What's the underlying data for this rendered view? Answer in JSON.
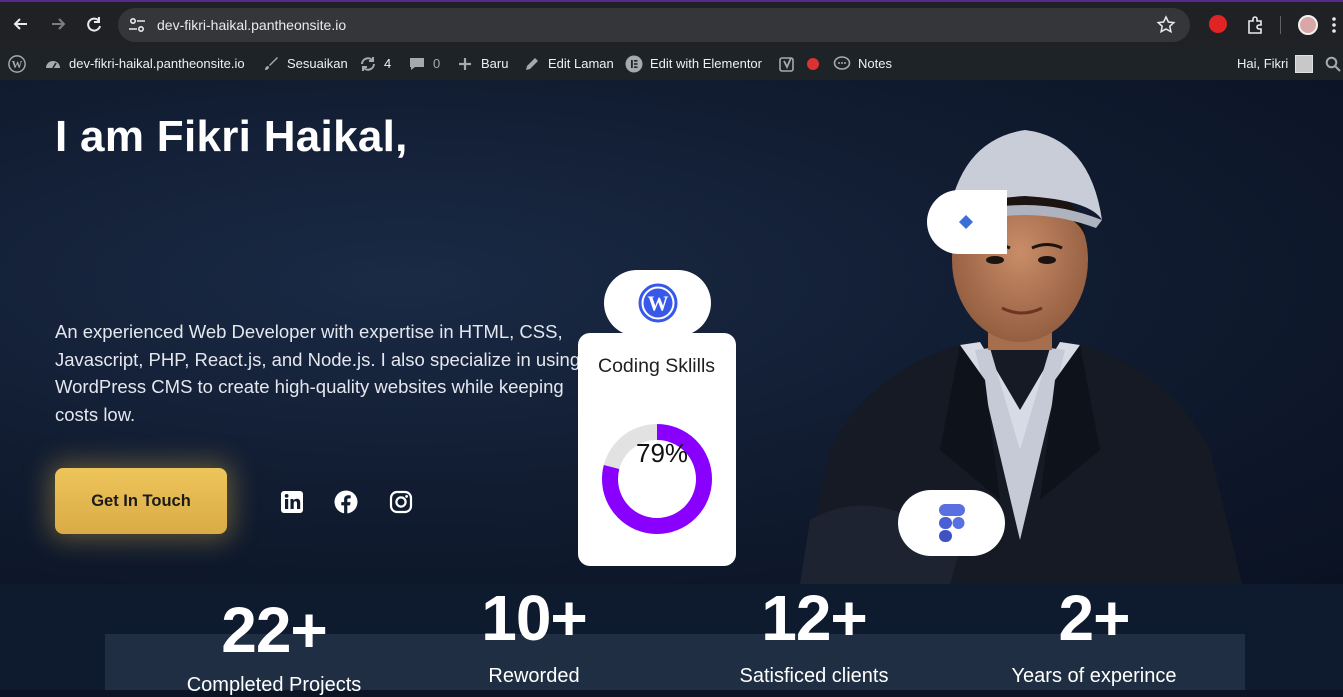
{
  "browser": {
    "url": "dev-fikri-haikal.pantheonsite.io",
    "back_icon": "arrow-left-icon",
    "forward_icon": "arrow-right-icon",
    "reload_icon": "reload-icon",
    "bookmark_icon": "star-icon"
  },
  "adminbar": {
    "site_name": "dev-fikri-haikal.pantheonsite.io",
    "customize": "Sesuaikan",
    "updates_count": "4",
    "comments_count": "0",
    "new": "Baru",
    "edit_page": "Edit Laman",
    "edit_elementor": "Edit with Elementor",
    "notes": "Notes",
    "greeting": "Hai, Fikri"
  },
  "hero": {
    "title": "I am Fikri Haikal,",
    "description": "An experienced Web Developer with expertise in HTML, CSS, Javascript, PHP, React.js, and Node.js. I also specialize in using WordPress CMS to create high-quality websites while keeping costs low.",
    "cta_label": "Get In Touch",
    "social": [
      "linkedin-icon",
      "facebook-icon",
      "instagram-icon"
    ]
  },
  "skills_card": {
    "title": "Coding Sklills",
    "percent": 79,
    "percent_label": "79%",
    "accent": "#8a00ff"
  },
  "stats": [
    {
      "number": "22+",
      "label": "Completed Projects"
    },
    {
      "number": "10+",
      "label": "Reworded"
    },
    {
      "number": "12+",
      "label": "Satisficed clients"
    },
    {
      "number": "2+",
      "label": "Years of experince"
    }
  ],
  "colors": {
    "accent_gold": "#e6bb55",
    "hero_bg": "#111c31",
    "adminbar_bg": "#1d2327",
    "chrome_bg": "#202124"
  }
}
